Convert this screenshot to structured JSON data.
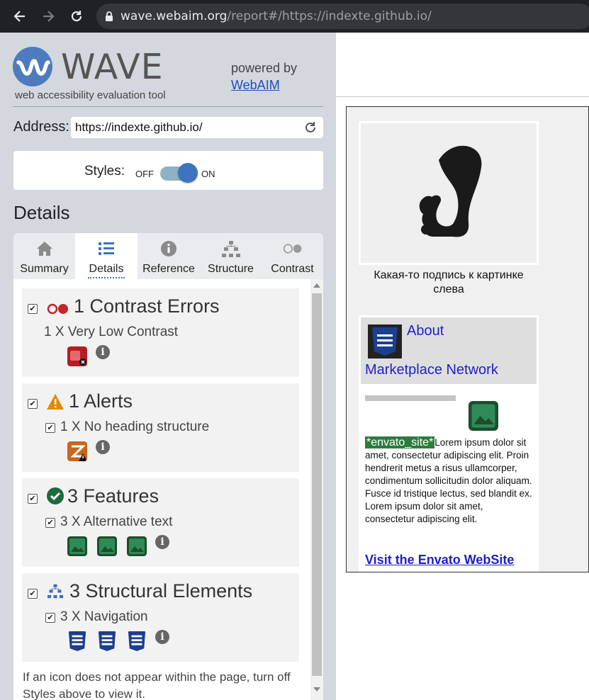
{
  "browser": {
    "url_host": "wave.webaim.org",
    "url_rest": "/report#/https://indexte.github.io/"
  },
  "sidebar": {
    "logo_word": "WAVE",
    "logo_tagline": "web accessibility evaluation tool",
    "powered_by": "powered by",
    "powered_link": "WebAIM",
    "address_label": "Address:",
    "address_value": "https://indexte.github.io/",
    "styles_label": "Styles:",
    "styles_off": "OFF",
    "styles_on": "ON",
    "details_heading": "Details",
    "tabs": [
      {
        "label": "Summary",
        "icon": "home-icon"
      },
      {
        "label": "Details",
        "icon": "list-icon"
      },
      {
        "label": "Reference",
        "icon": "info-icon"
      },
      {
        "label": "Structure",
        "icon": "sitemap-icon"
      },
      {
        "label": "Contrast",
        "icon": "contrast-icon"
      }
    ],
    "cards": [
      {
        "title": "1 Contrast Errors",
        "item": "1 X Very Low Contrast",
        "icon": "contrast-error-icon",
        "color": "#c0272d"
      },
      {
        "title": "1 Alerts",
        "item": "1 X No heading structure",
        "icon": "alert-icon",
        "color": "#e08a00"
      },
      {
        "title": "3 Features",
        "item": "3 X Alternative text",
        "icon": "feature-icon",
        "color": "#1e6b3c"
      },
      {
        "title": "3 Structural Elements",
        "item": "3 X Navigation",
        "icon": "structure-icon",
        "color": "#1c3f8e"
      }
    ],
    "footnote": "If an icon does not appear within the page, turn off Styles above to view it."
  },
  "page": {
    "caption": "Какая-то подпись к картинке слева",
    "nav_about": "About",
    "nav_market": "Marketplace Network",
    "envato_tag": "*envato_site*",
    "lorem": "Lorem ipsum dolor sit amet, consectetur adipiscing elit. Proin hendrerit metus a risus ullamcorper, condimentum sollicitudin dolor aliquam. Fusce id tristique lectus, sed blandit ex. Lorem ipsum dolor sit amet, consectetur adipiscing elit.",
    "visit_link": "Visit the Envato WebSite"
  }
}
